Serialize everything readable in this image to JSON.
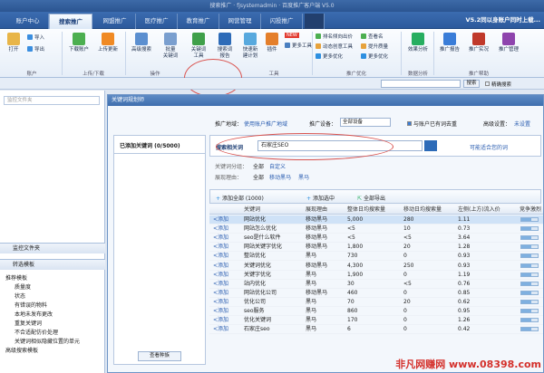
{
  "window": {
    "title": "搜索推广 · fjsystemadmin · 百度推广客户端 V5.0"
  },
  "tabs": [
    "账户中心",
    "搜索推广",
    "网盟推广",
    "医疗推广",
    "教育推广",
    "网营管理",
    "闪投推广"
  ],
  "version_text": "V5.2同以身账户同时上载...",
  "ribbon": {
    "open": "打开",
    "import": "导入",
    "export": "导出",
    "download_acc": "下载账户",
    "upload_acc": "上传更新",
    "advanced_search": "高级搜索",
    "edit_kw": "批量\n关键词",
    "kw_tool": "关键词\n工具",
    "search_report": "搜索词\n报告",
    "quick_new": "快速新\n建计划",
    "plugin": "插件",
    "more_tools": "更多工具",
    "sort_group": "排名倾向出价",
    "auto_rule": "动态创意工具",
    "more_opt": "更多优化",
    "view_score": "查看名",
    "boost_rank": "提升质量",
    "more_analysis": "更多优化",
    "effect_analysis": "效果分析",
    "promo_report": "推广报告",
    "promo_practice": "推广实况",
    "promo_mgmt": "推广管理",
    "new_badge": "NEW",
    "groups": [
      "账户",
      "上传/下载",
      "操作",
      "工具",
      "",
      "推广优化",
      "数据分析",
      "推广帮助"
    ]
  },
  "addr": {
    "search_btn": "搜索",
    "exact_match": "精确搜索"
  },
  "left": {
    "search_placeholder": "监控文件夹",
    "section1": "监控文件夹",
    "section2": "转选模板",
    "tree": [
      "推荐模板",
      "质量度",
      "状态",
      "有错误的物料",
      "本地未发布更改",
      "重复关键词",
      "不合适配仿价处理",
      "关键词相似隐藏位置的单元",
      "高级搜索模板"
    ]
  },
  "dialog": {
    "title": "关键词规划师",
    "region_label": "推广地域：",
    "region_value": "使用账户推广地域",
    "device_label": "推广设备：",
    "device_value": "全部设备",
    "exclude_label": "与账户已有词去重",
    "adv_label": "高级设置：",
    "adv_value": "未设置",
    "added_title": "已添加关键词 (0/5000)",
    "search_by": "搜索相关词",
    "search_value": "石家庄SEO",
    "related_link": "可能适合您的词",
    "cat_label": "关键词分组：",
    "cat_all": "全部",
    "cat_custom": "自定义",
    "reason_label": "展现理由：",
    "reason_all": "全部",
    "reason1": "移动黑马",
    "reason2": "黑马",
    "add_all": "添加全部 (1000)",
    "add_selected": "添加选中",
    "export_all": "全部导出",
    "view_btn": "查看种族",
    "columns": [
      "",
      "关键词",
      "展现理由",
      "整体日均搜索量",
      "移动日均搜索量",
      "左侧(上方)流入价",
      "竞争激烈"
    ],
    "add_link": "<添加"
  },
  "rows": [
    [
      "网站优化",
      "移动黑马",
      "5,000",
      "280",
      "1.11"
    ],
    [
      "网站怎么优化",
      "移动黑马",
      "<5",
      "10",
      "0.73"
    ],
    [
      "seo是什么软件",
      "移动黑马",
      "<5",
      "<5",
      "3.64"
    ],
    [
      "网站关键字优化",
      "移动黑马",
      "1,800",
      "20",
      "1.28"
    ],
    [
      "整站优化",
      "黑马",
      "730",
      "0",
      "0.93"
    ],
    [
      "关键词优化",
      "移动黑马",
      "4,300",
      "250",
      "0.93"
    ],
    [
      "关键字优化",
      "黑马",
      "1,900",
      "0",
      "1.19"
    ],
    [
      "站内优化",
      "黑马",
      "30",
      "<5",
      "0.76"
    ],
    [
      "网站优化公司",
      "移动黑马",
      "460",
      "0",
      "0.85"
    ],
    [
      "优化公司",
      "黑马",
      "70",
      "20",
      "0.62"
    ],
    [
      "seo服务",
      "黑马",
      "860",
      "0",
      "0.95"
    ],
    [
      "优化关键词",
      "黑马",
      "170",
      "0",
      "1.26"
    ],
    [
      "石家庄seo",
      "黑马",
      "6",
      "0",
      "0.42"
    ]
  ],
  "watermark": "非凡网赚网 www.08398.com"
}
